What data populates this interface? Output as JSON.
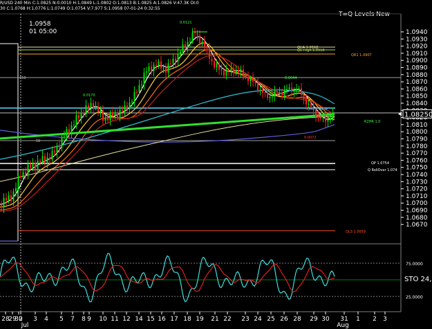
{
  "header": {
    "line1": "R/USD 240 Min  C:1.0825  N:0.0010  H:1.0849  L:1.0802  O:1.0813  B:1.0825  A:1.0826  V:47.3K  OI:0",
    "line2": "30  C:1.0768  H:1.0776  L:1.0749  O:1.0754  V:7.977  S:1.0958  07-01-24  0:32:55"
  },
  "info": {
    "price": "1.0958",
    "time": "01 05:00"
  },
  "levels_title": "T=Q Levels New",
  "price_axis": {
    "ticks": [
      "1.0940",
      "1.0930",
      "1.0920",
      "1.0910",
      "1.0900",
      "1.0890",
      "1.0880",
      "1.0870",
      "1.0860",
      "1.0850",
      "1.0840",
      "1.0830",
      "1.0820",
      "1.0810",
      "1.0800",
      "1.0790",
      "1.0780",
      "1.0770",
      "1.0760",
      "1.0750",
      "1.0740",
      "1.0730",
      "1.0720",
      "1.0710",
      "1.0700",
      "1.0690",
      "1.0680",
      "1.0670"
    ],
    "current": "1.08250"
  },
  "chart_labels": {
    "high_label": "0.0121",
    "left_label": "0.0170",
    "mid_label": "0.0044",
    "low_label": "0.0072",
    "level_150": "150",
    "level_50": "50"
  },
  "level_labels": [
    {
      "text": "QHA 1.0918",
      "color": "#e6e6a0"
    },
    {
      "text": "QC High 1.0918",
      "color": "#b0e040"
    },
    {
      "text": "QR1 1.0907",
      "color": "#ffa040"
    },
    {
      "text": "QH3 1.0832",
      "color": "#60d8ff"
    },
    {
      "text": "R2HR 1.0",
      "color": "#40ff40"
    },
    {
      "text": "QP 1.0754",
      "color": "#ffffff"
    },
    {
      "text": "Q RollOver 1.074",
      "color": "#ffffff"
    },
    {
      "text": "QL3 1.0659",
      "color": "#ff5020"
    }
  ],
  "oscillator": {
    "label": "STO 24,",
    "ticks": [
      "75.0000",
      "25.0000"
    ]
  },
  "date_axis": {
    "labels": [
      "28",
      "29",
      "30",
      "Jul",
      "2",
      "3",
      "4",
      "5",
      "7",
      "8",
      "9",
      "10",
      "11",
      "12",
      "14",
      "15",
      "16",
      "17",
      "18",
      "19",
      "21",
      "22",
      "23",
      "24",
      "25",
      "26",
      "28",
      "29",
      "30",
      "31",
      "1",
      "2",
      "Aug",
      "3"
    ],
    "month_labels": [
      "Jul",
      "Aug"
    ]
  },
  "colors": {
    "background": "#000000",
    "axis_text": "#ffffff",
    "bull_candle": "#00e000",
    "bear_candle": "#ff2020",
    "ma_white": "#ffffff",
    "ma_yellow": "#ffd040",
    "ma_orange": "#ff7000",
    "ma_red": "#c02020",
    "ma_cyan": "#30c0d0",
    "ma_blue": "#6060e0",
    "ma_green": "#30e030",
    "stoch_fast": "#40e0e0",
    "stoch_slow": "#e02020"
  }
}
